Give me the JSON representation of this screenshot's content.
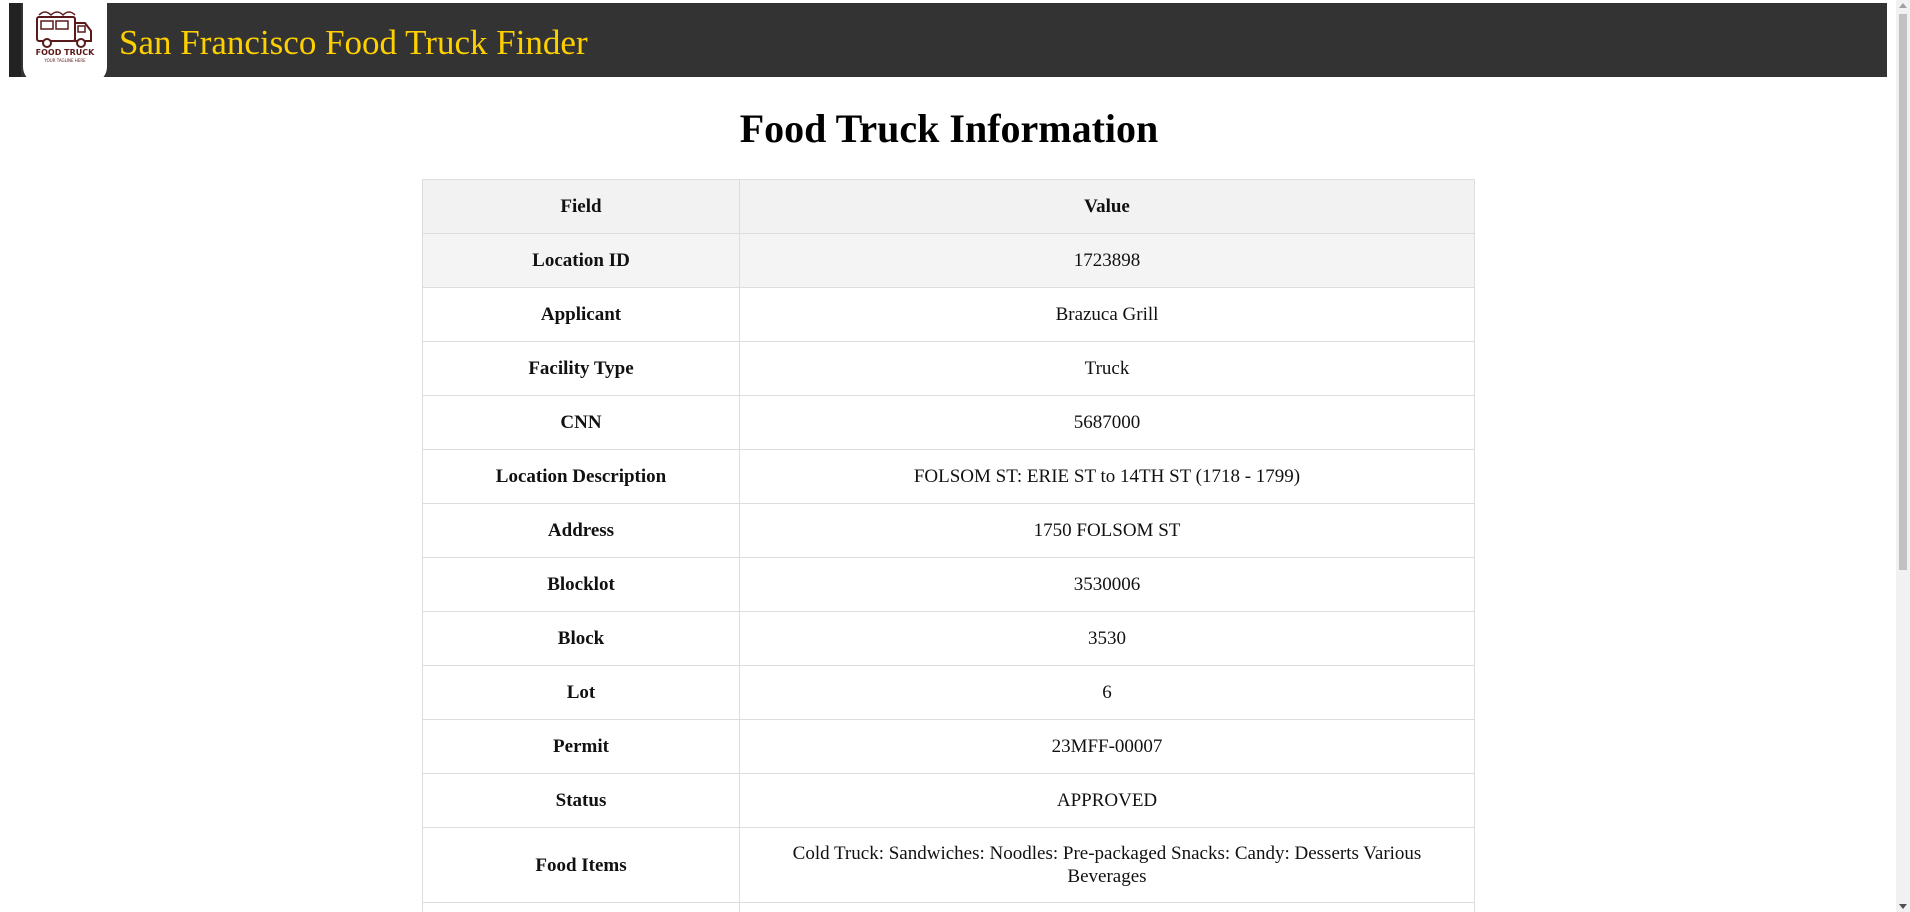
{
  "header": {
    "title": "San Francisco Food Truck Finder",
    "logo_text": "FOOD TRUCK",
    "logo_tagline": "YOUR TAGLINE HERE",
    "title_color": "#ffd000",
    "background_color": "#333333"
  },
  "main": {
    "heading": "Food Truck Information",
    "table": {
      "columns": [
        "Field",
        "Value"
      ],
      "rows": [
        {
          "field": "Location ID",
          "value": "1723898"
        },
        {
          "field": "Applicant",
          "value": "Brazuca Grill"
        },
        {
          "field": "Facility Type",
          "value": "Truck"
        },
        {
          "field": "CNN",
          "value": "5687000"
        },
        {
          "field": "Location Description",
          "value": "FOLSOM ST: ERIE ST to 14TH ST (1718 - 1799)"
        },
        {
          "field": "Address",
          "value": "1750 FOLSOM ST"
        },
        {
          "field": "Blocklot",
          "value": "3530006"
        },
        {
          "field": "Block",
          "value": "3530"
        },
        {
          "field": "Lot",
          "value": "6"
        },
        {
          "field": "Permit",
          "value": "23MFF-00007"
        },
        {
          "field": "Status",
          "value": "APPROVED"
        },
        {
          "field": "Food Items",
          "value": "Cold Truck: Sandwiches: Noodles: Pre-packaged Snacks: Candy: Desserts Various Beverages"
        }
      ]
    }
  }
}
